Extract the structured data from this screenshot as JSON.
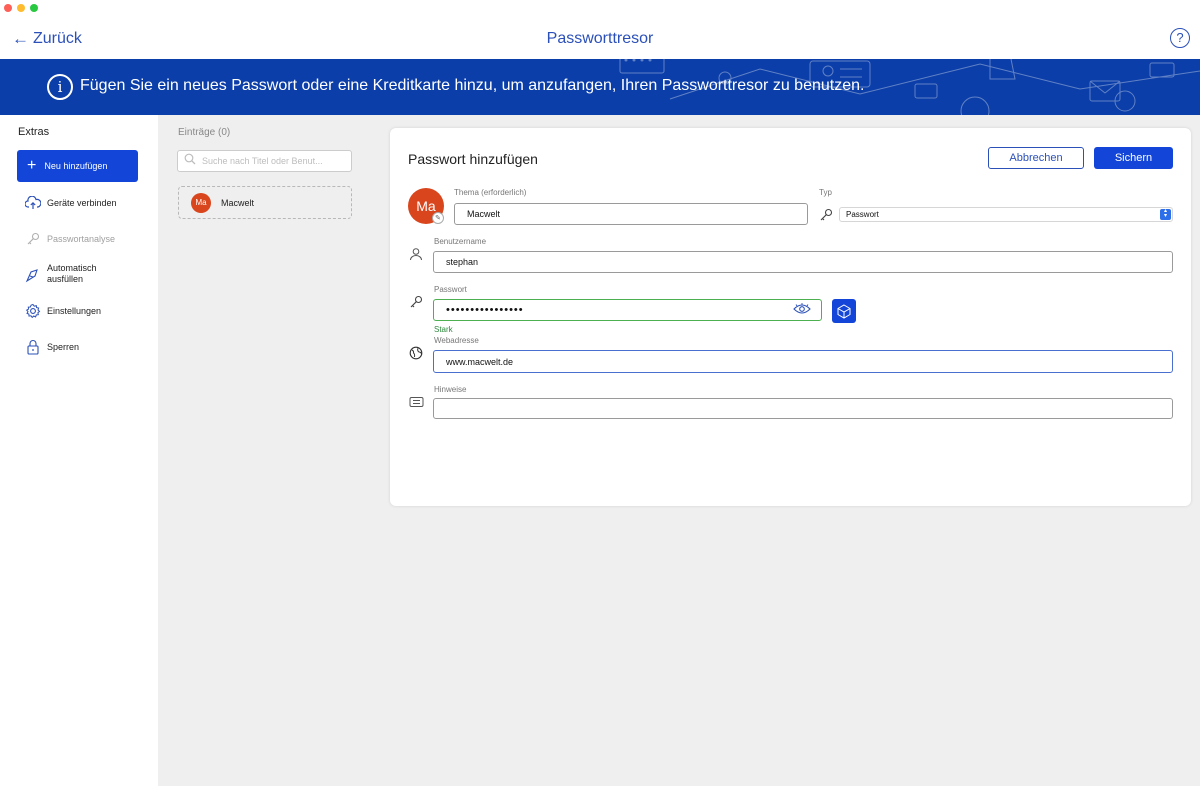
{
  "window": {
    "traffic_colors": [
      "#fe5f57",
      "#febc2e",
      "#28c840"
    ]
  },
  "header": {
    "back_label": "Zurück",
    "title": "Passworttresor",
    "help_label": "?"
  },
  "banner": {
    "text": "Fügen Sie ein neues Passwort oder eine Kreditkarte hinzu, um anzufangen, Ihren Passworttresor zu benutzen.",
    "info_glyph": "i",
    "background": "#0b3ea8"
  },
  "sidebar": {
    "heading": "Extras",
    "add_button": "Neu hinzufügen",
    "items": [
      {
        "label": "Geräte verbinden",
        "icon": "cloud-upload-icon",
        "enabled": true
      },
      {
        "label": "Passwortanalyse",
        "icon": "key-icon",
        "enabled": false
      },
      {
        "label": "Automatisch\nausfüllen",
        "icon": "autofill-icon",
        "enabled": true
      },
      {
        "label": "Einstellungen",
        "icon": "gear-icon",
        "enabled": true
      },
      {
        "label": "Sperren",
        "icon": "lock-icon",
        "enabled": true
      }
    ]
  },
  "list": {
    "heading": "Einträge (0)",
    "search_placeholder": "Suche nach Titel oder Benut...",
    "entries": [
      {
        "avatar": "Ma",
        "title": "Macwelt"
      }
    ]
  },
  "form": {
    "title": "Passwort hinzufügen",
    "cancel_label": "Abbrechen",
    "save_label": "Sichern",
    "avatar": "Ma",
    "subject": {
      "label": "Thema (erforderlich)",
      "value": "Macwelt"
    },
    "type": {
      "label": "Typ",
      "value": "Passwort"
    },
    "username": {
      "label": "Benutzername",
      "value": "stephan"
    },
    "password": {
      "label": "Passwort",
      "value": "••••••••••••••••",
      "strength": "Stark"
    },
    "website": {
      "label": "Webadresse",
      "value": "www.macwelt.de"
    },
    "notes": {
      "label": "Hinweise",
      "value": ""
    }
  },
  "colors": {
    "accent": "#1245d8",
    "link": "#2b50b8",
    "avatar": "#d9451c",
    "strong": "#4caf50"
  }
}
